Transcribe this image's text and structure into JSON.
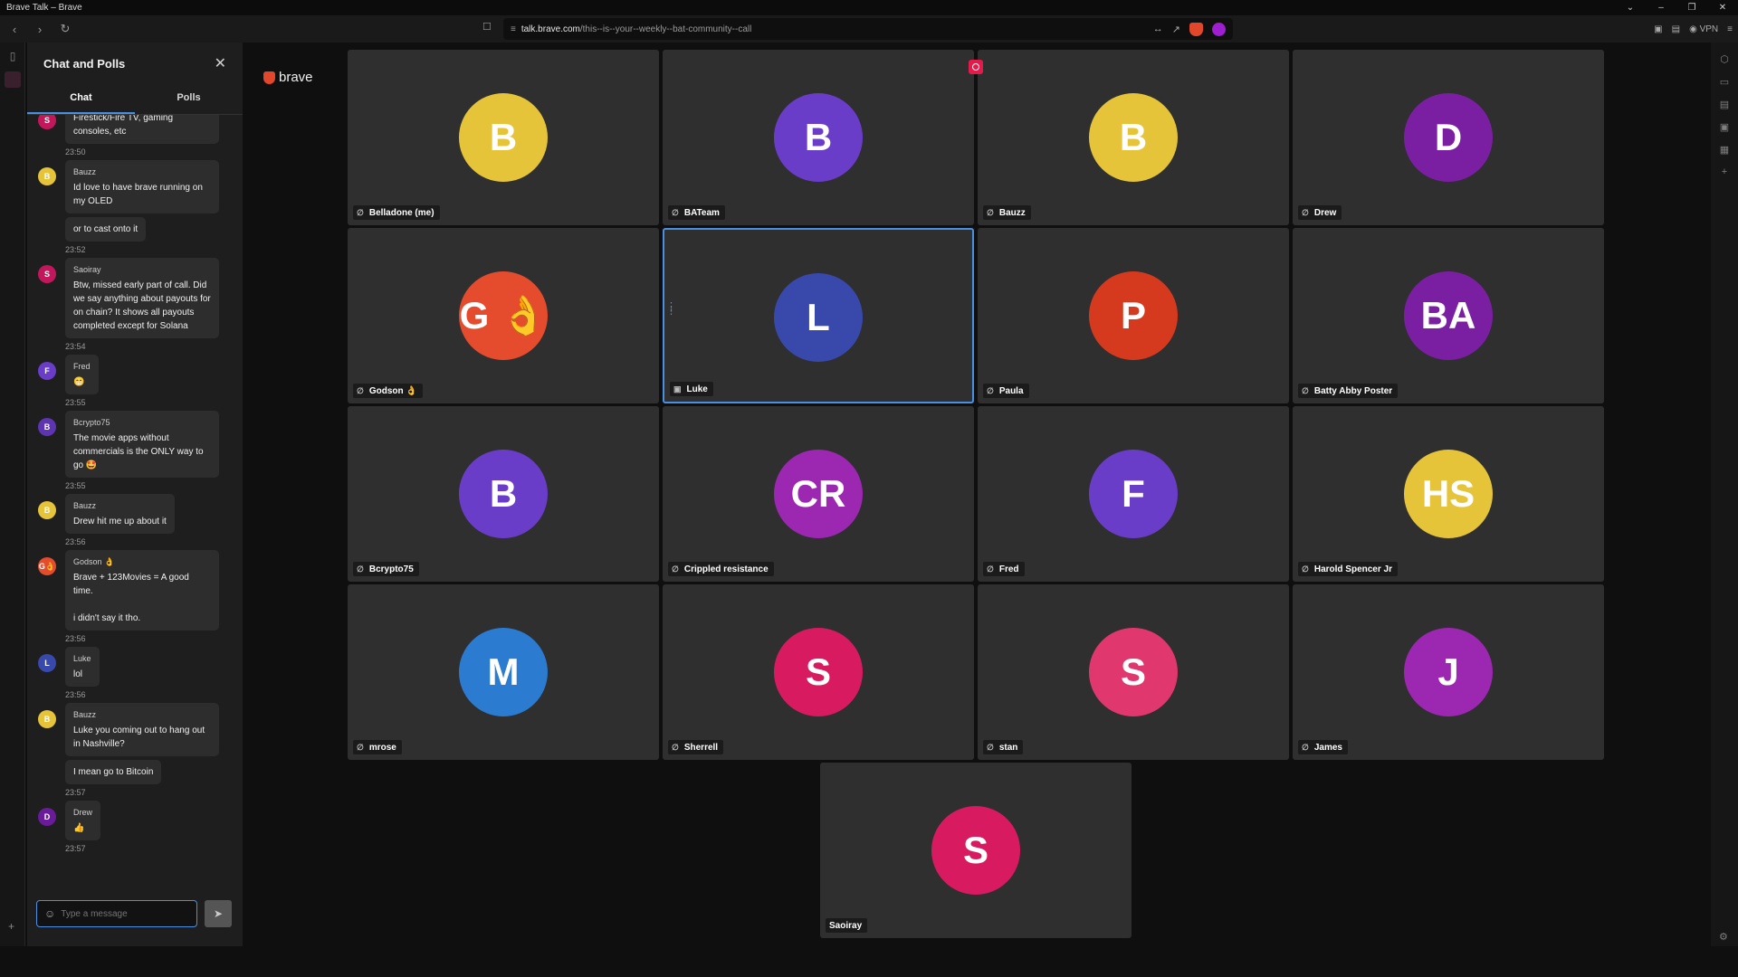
{
  "window": {
    "title": "Brave Talk – Brave",
    "controls": [
      "⌄",
      "–",
      "❐",
      "✕"
    ]
  },
  "toolbar": {
    "url_host": "talk.brave.com",
    "url_path": "/this--is--your--weekly--bat-community--call",
    "vpn_label": "VPN"
  },
  "chat": {
    "title": "Chat and Polls",
    "close_icon": "close-icon",
    "tabs": [
      "Chat",
      "Polls"
    ],
    "active_tab": "Chat",
    "placeholder": "Type a message",
    "messages": [
      {
        "id": "m1",
        "sender": "",
        "initial": "S",
        "color": "#c2185b",
        "lines": [
          "Firestick/Fire TV, gaming consoles, etc"
        ],
        "time": "23:50"
      },
      {
        "id": "m2",
        "sender": "Bauzz",
        "initial": "B",
        "color": "#e6c43a",
        "lines": [
          "Id love to have brave running on my OLED"
        ],
        "extra": "or to cast onto it",
        "time": "23:52"
      },
      {
        "id": "m3",
        "sender": "Saoiray",
        "initial": "S",
        "color": "#c2185b",
        "lines": [
          "Btw, missed early part of call. Did we say anything about payouts for on chain? It shows all payouts completed except for Solana"
        ],
        "time": "23:54"
      },
      {
        "id": "m4",
        "sender": "Fred",
        "initial": "F",
        "color": "#6a3dc9",
        "lines": [
          "😁"
        ],
        "time": "23:55"
      },
      {
        "id": "m5",
        "sender": "Bcrypto75",
        "initial": "B",
        "color": "#5e35b1",
        "lines": [
          "The movie apps without commercials is the ONLY way to go 🤩"
        ],
        "time": "23:55"
      },
      {
        "id": "m6",
        "sender": "Bauzz",
        "initial": "B",
        "color": "#e6c43a",
        "lines": [
          "Drew hit me up about it"
        ],
        "time": "23:56"
      },
      {
        "id": "m7",
        "sender": "Godson 👌",
        "initial": "G👌",
        "color": "#e54b2d",
        "lines": [
          "Brave + 123Movies = A good time.",
          "",
          "i didn't say it tho."
        ],
        "time": "23:56"
      },
      {
        "id": "m8",
        "sender": "Luke",
        "initial": "L",
        "color": "#3949ab",
        "lines": [
          "lol"
        ],
        "time": "23:56"
      },
      {
        "id": "m9",
        "sender": "Bauzz",
        "initial": "B",
        "color": "#e6c43a",
        "lines": [
          "Luke you coming out to hang out in Nashville?"
        ],
        "extra": "I mean go to Bitcoin",
        "time": "23:57"
      },
      {
        "id": "m10",
        "sender": "Drew",
        "initial": "D",
        "color": "#6a1b9a",
        "lines": [
          "👍"
        ],
        "time": "23:57"
      }
    ]
  },
  "brand": {
    "wordmark": "brave"
  },
  "participants": [
    {
      "name": "Belladone (me)",
      "initial": "B",
      "bg": "#e6c43a",
      "mic": "muted"
    },
    {
      "name": "BATeam",
      "initial": "B",
      "bg": "#6a3dc9",
      "mic": "muted"
    },
    {
      "name": "Bauzz",
      "initial": "B",
      "bg": "#e6c43a",
      "mic": "muted"
    },
    {
      "name": "Drew",
      "initial": "D",
      "bg": "#7b1fa2",
      "mic": "muted"
    },
    {
      "name": "Godson 👌",
      "initial": "G 👌",
      "bg": "#e54b2d",
      "mic": "muted"
    },
    {
      "name": "Luke",
      "initial": "L",
      "bg": "#3949ab",
      "mic": "camera",
      "active": true
    },
    {
      "name": "Paula",
      "initial": "P",
      "bg": "#d63a1e",
      "mic": "muted"
    },
    {
      "name": "Batty Abby Poster",
      "initial": "BA",
      "bg": "#7b1fa2",
      "mic": "muted"
    },
    {
      "name": "Bcrypto75",
      "initial": "B",
      "bg": "#6a3dc9",
      "mic": "muted"
    },
    {
      "name": "Crippled resistance",
      "initial": "CR",
      "bg": "#9c27b0",
      "mic": "muted"
    },
    {
      "name": "Fred",
      "initial": "F",
      "bg": "#6a3dc9",
      "mic": "muted"
    },
    {
      "name": "Harold Spencer Jr",
      "initial": "HS",
      "bg": "#e6c43a",
      "mic": "muted"
    },
    {
      "name": "mrose",
      "initial": "M",
      "bg": "#2b7bd1",
      "mic": "muted"
    },
    {
      "name": "Sherrell",
      "initial": "S",
      "bg": "#d81b60",
      "mic": "muted"
    },
    {
      "name": "stan",
      "initial": "S",
      "bg": "#e0386e",
      "mic": "muted"
    },
    {
      "name": "James",
      "initial": "J",
      "bg": "#9c27b0",
      "mic": "muted"
    },
    {
      "name": "Saoiray",
      "initial": "S",
      "bg": "#d81b60",
      "mic": "none"
    }
  ]
}
